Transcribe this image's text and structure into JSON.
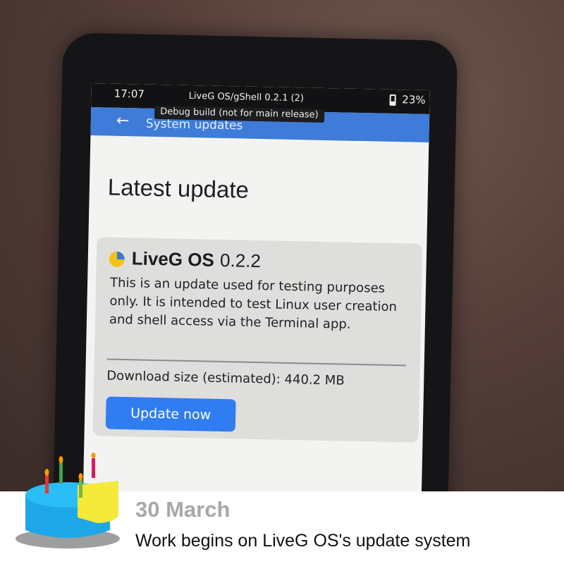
{
  "status_bar": {
    "time": "17:07",
    "center_text": "LiveG OS/gShell 0.2.1 (2)",
    "debug_label": "Debug build (not for main release)",
    "battery_percent": "23%"
  },
  "app_bar": {
    "back_icon": "arrow-left-icon",
    "title": "System updates"
  },
  "content": {
    "title": "Latest update",
    "update_card": {
      "logo_icon": "liveg-logo-icon",
      "os_name": "LiveG OS",
      "version": "0.2.2",
      "description": "This is an update used for testing purposes only. It is intended to test Linux user creation and shell access via the Terminal app.",
      "download_size": "Download size (estimated): 440.2 MB",
      "button_label": "Update now"
    }
  },
  "banner": {
    "date": "30 March",
    "caption": "Work begins on LiveG OS's update system",
    "cake_icon": "birthday-cake-icon"
  },
  "colors": {
    "accent": "#2f7df0",
    "app_bar": "#3f7bd8",
    "logo_blue": "#3a78d8",
    "logo_yellow": "#f2c318"
  }
}
